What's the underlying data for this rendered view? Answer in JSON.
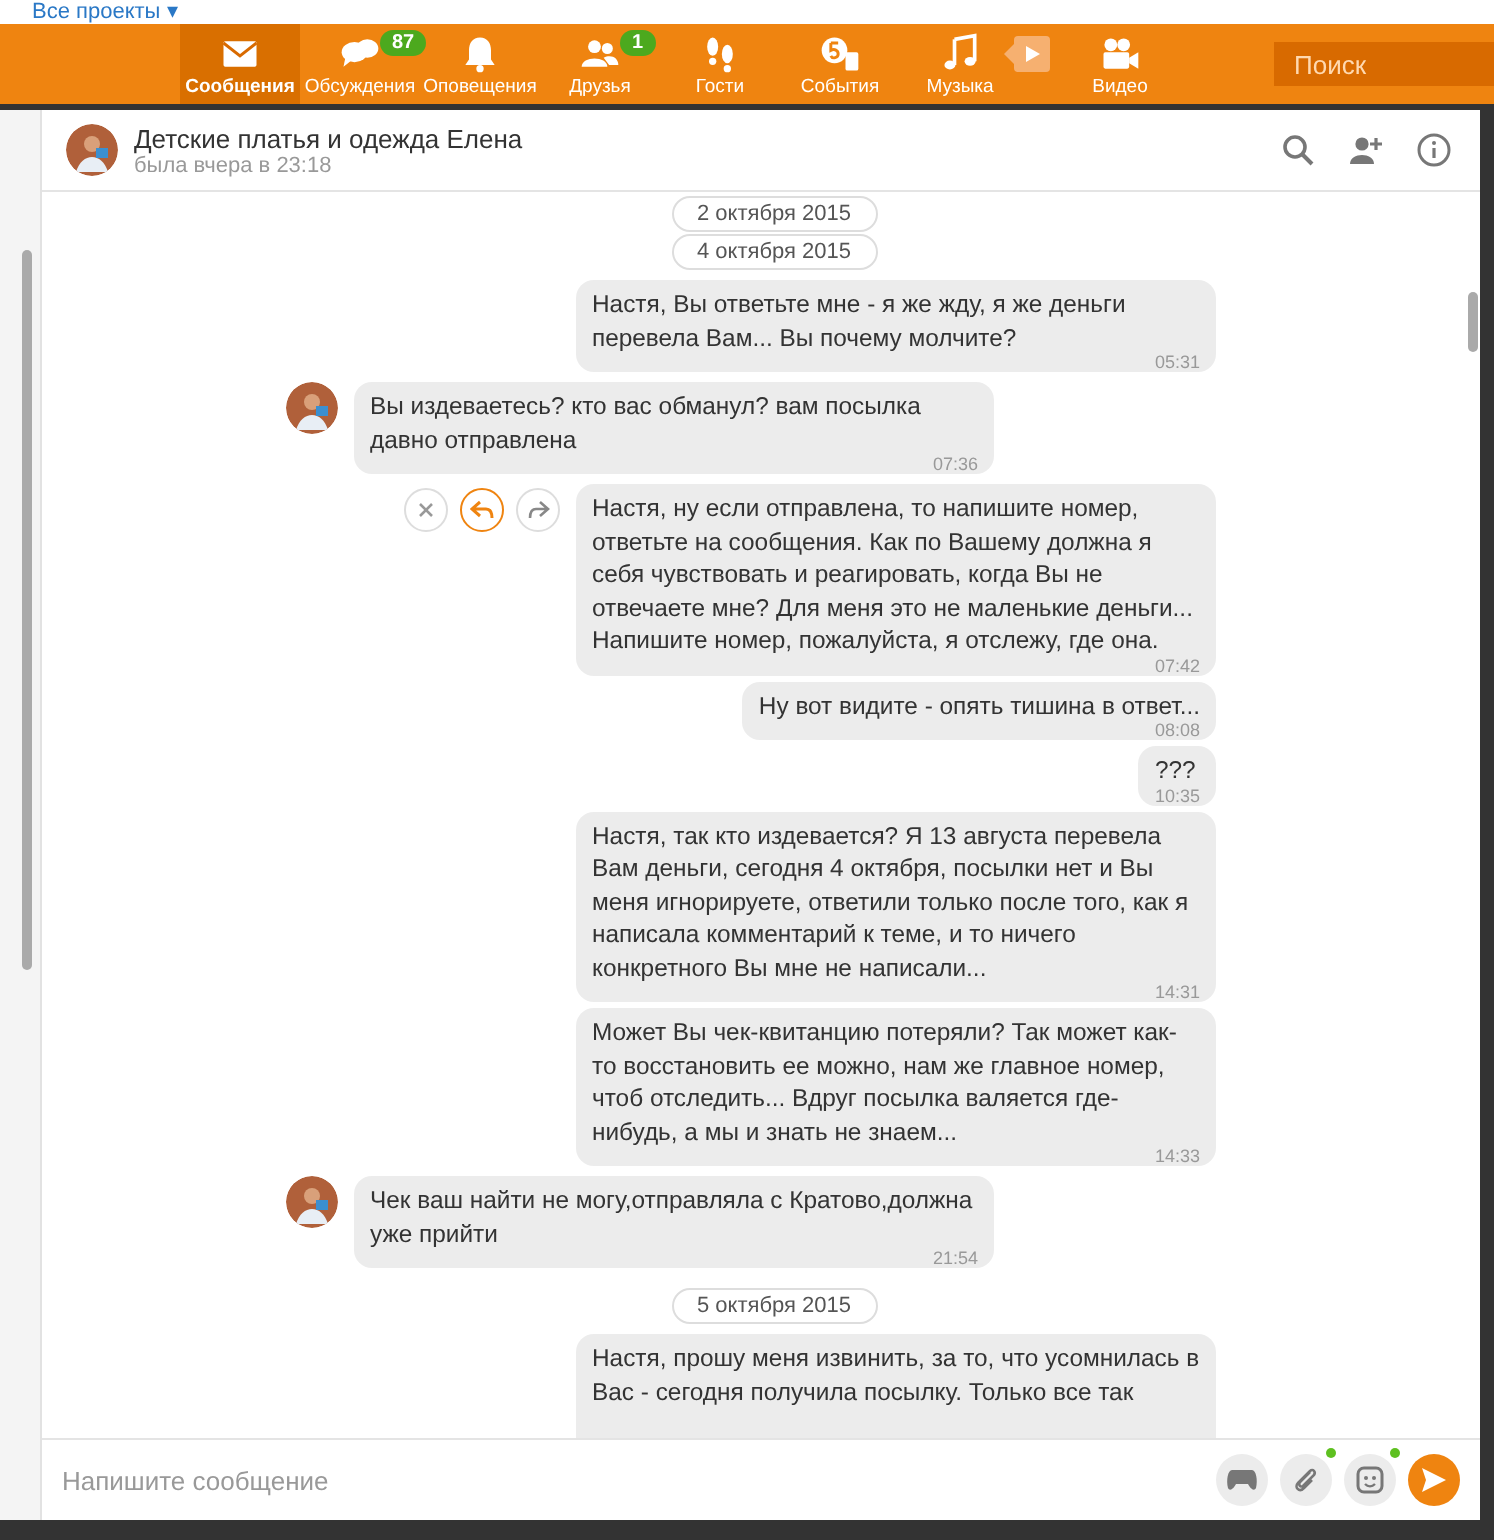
{
  "top_link": "Все проекты ▾",
  "nav": [
    {
      "label": "Сообщения",
      "selected": true
    },
    {
      "label": "Обсуждения",
      "selected": false,
      "badge": "87"
    },
    {
      "label": "Оповещения",
      "selected": false
    },
    {
      "label": "Друзья",
      "selected": false,
      "badge": "1"
    },
    {
      "label": "Гости",
      "selected": false
    },
    {
      "label": "События",
      "selected": false
    },
    {
      "label": "Музыка",
      "selected": false
    },
    {
      "label": "Видео",
      "selected": false
    }
  ],
  "search": {
    "placeholder": "Поиск"
  },
  "chat": {
    "title": "Детские платья и одежда Елена",
    "status": "была вчера в 23:18"
  },
  "messages": [
    {
      "kind": "date",
      "text": "2 октября 2015"
    },
    {
      "kind": "date",
      "text": "4 октября 2015"
    },
    {
      "kind": "out",
      "text": "Настя, Вы ответьте мне - я же жду, я же деньги перевела Вам... Вы почему молчите?",
      "time": "05:31",
      "actions": false
    },
    {
      "kind": "in",
      "text": "Вы издеваетесь? кто вас обманул? вам посылка давно отправлена",
      "time": "07:36",
      "actions": false
    },
    {
      "kind": "out",
      "text": "Настя, ну если отправлена, то напишите номер, ответьте на сообщения. Как по Вашему должна я себя чувствовать и реагировать, когда Вы не отвечаете мне? Для меня это не маленькие деньги... Напишите номер, пожалуйста, я отслежу, где она.",
      "time": "07:42",
      "actions": true
    },
    {
      "kind": "out",
      "text": "Ну вот видите - опять тишина в ответ...",
      "time": "08:08",
      "actions": false
    },
    {
      "kind": "out",
      "text": "???",
      "time": "10:35",
      "actions": false
    },
    {
      "kind": "out",
      "text": "Настя, так кто издевается? Я 13 августа перевела Вам деньги, сегодня 4 октября, посылки нет и Вы меня игнорируете, ответили только после того, как я написала комментарий к теме, и то ничего конкретного Вы мне не написали...",
      "time": "14:31",
      "actions": false
    },
    {
      "kind": "out",
      "text": "Может Вы чек-квитанцию потеряли? Так может как-то восстановить ее можно, нам же главное номер, чтоб отследить... Вдруг посылка валяется где-нибудь, а мы и знать не знаем...",
      "time": "14:33",
      "actions": false
    },
    {
      "kind": "in",
      "text": "Чек ваш найти не могу,отправляла с Кратово,должна уже прийти",
      "time": "21:54",
      "actions": false
    },
    {
      "kind": "date",
      "text": "5 октября 2015"
    },
    {
      "kind": "out",
      "text": "Настя, прошу меня извинить, за то, что усомнилась в Вас - сегодня получила посылку. Только все так",
      "actions": false
    }
  ],
  "composer": {
    "placeholder": "Напишите сообщение"
  }
}
